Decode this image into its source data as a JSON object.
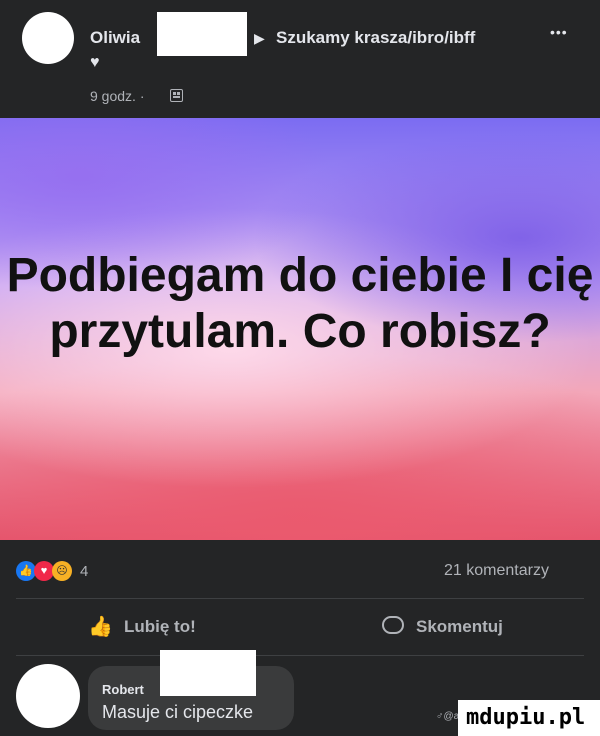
{
  "post": {
    "author": "Oliwia",
    "group_arrow": "▶",
    "group": "Szukamy krasza/ibro/ibff",
    "more": "•••",
    "heart": "♥",
    "time": "9 godz. ·"
  },
  "banner": {
    "text": "Podbiegam do ciebie I cię przytulam. Co robisz?"
  },
  "reactions": {
    "count": "4",
    "comments": "21 komentarzy"
  },
  "actions": {
    "like": "Lubię to!",
    "comment": "Skomentuj"
  },
  "comment": {
    "author": "Robert",
    "text": "Masuje ci cipeczke"
  },
  "watermark": {
    "small": "♂@an",
    "logo": "mdupiu.pl"
  },
  "colors": {
    "background": "#242526",
    "text_primary": "#e4e6eb",
    "text_secondary": "#b0b3b8",
    "like_blue": "#1877f2",
    "love_red": "#f02849",
    "haha_yellow": "#f7b125"
  }
}
